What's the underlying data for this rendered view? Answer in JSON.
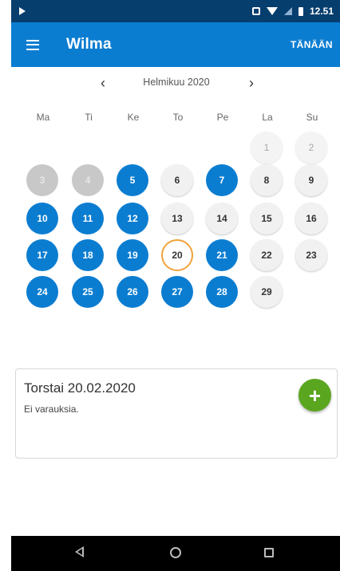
{
  "status_bar": {
    "time": "12.51"
  },
  "app_bar": {
    "title": "Wilma",
    "today_label": "TÄNÄÄN"
  },
  "calendar": {
    "month_label": "Helmikuu 2020",
    "weekdays": [
      "Ma",
      "Ti",
      "Ke",
      "To",
      "Pe",
      "La",
      "Su"
    ],
    "days": [
      {
        "n": "1",
        "style": "dim"
      },
      {
        "n": "2",
        "style": "dim"
      },
      {
        "n": "3",
        "style": "grey"
      },
      {
        "n": "4",
        "style": "grey"
      },
      {
        "n": "5",
        "style": "blue"
      },
      {
        "n": "6",
        "style": "white"
      },
      {
        "n": "7",
        "style": "blue"
      },
      {
        "n": "8",
        "style": "white"
      },
      {
        "n": "9",
        "style": "white"
      },
      {
        "n": "10",
        "style": "blue"
      },
      {
        "n": "11",
        "style": "blue"
      },
      {
        "n": "12",
        "style": "blue"
      },
      {
        "n": "13",
        "style": "white"
      },
      {
        "n": "14",
        "style": "white"
      },
      {
        "n": "15",
        "style": "white"
      },
      {
        "n": "16",
        "style": "white"
      },
      {
        "n": "17",
        "style": "blue"
      },
      {
        "n": "18",
        "style": "blue"
      },
      {
        "n": "19",
        "style": "blue"
      },
      {
        "n": "20",
        "style": "today"
      },
      {
        "n": "21",
        "style": "blue"
      },
      {
        "n": "22",
        "style": "white"
      },
      {
        "n": "23",
        "style": "white"
      },
      {
        "n": "24",
        "style": "blue"
      },
      {
        "n": "25",
        "style": "blue"
      },
      {
        "n": "26",
        "style": "blue"
      },
      {
        "n": "27",
        "style": "blue"
      },
      {
        "n": "28",
        "style": "blue"
      },
      {
        "n": "29",
        "style": "white"
      }
    ]
  },
  "selected_day": {
    "title": "Torstai 20.02.2020",
    "subtitle": "Ei varauksia.",
    "add_icon": "+"
  },
  "colors": {
    "primary": "#0b7dd1",
    "status_bar": "#063e6e",
    "today_ring": "#f0a23a",
    "fab": "#5aa61f"
  }
}
